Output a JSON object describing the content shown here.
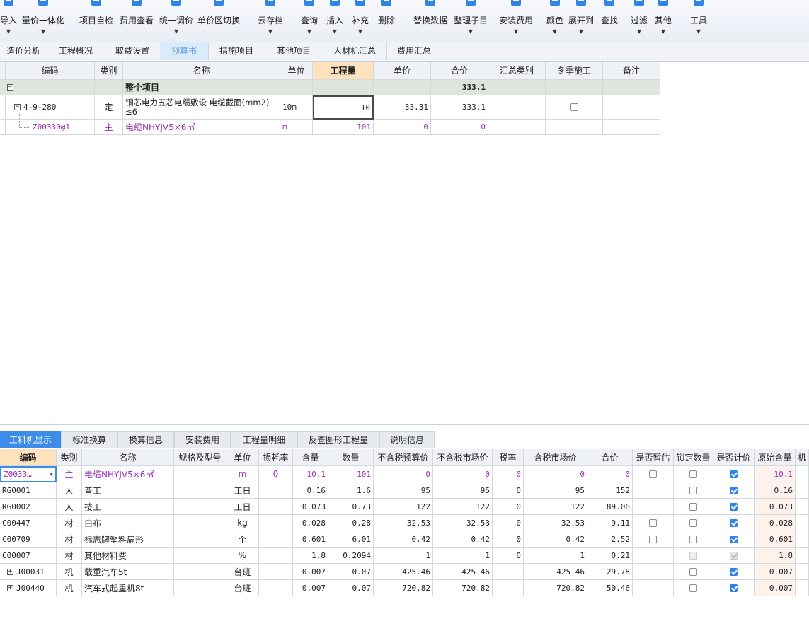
{
  "toolbar": {
    "buttons": [
      {
        "label": "导入",
        "icon": "import-icon",
        "dropdown": true
      },
      {
        "label": "量价一体化",
        "icon": "price-integration-icon",
        "dropdown": true
      },
      {
        "label": "项目自检",
        "icon": "self-check-icon",
        "dropdown": false
      },
      {
        "label": "费用查看",
        "icon": "fee-view-icon",
        "dropdown": false
      },
      {
        "label": "统一调价",
        "icon": "price-adjust-icon",
        "dropdown": true
      },
      {
        "label": "单价区切换",
        "icon": "price-area-switch-icon",
        "dropdown": false
      },
      {
        "label": "云存档",
        "icon": "cloud-archive-icon",
        "dropdown": true
      },
      {
        "label": "查询",
        "icon": "query-icon",
        "dropdown": true
      },
      {
        "label": "插入",
        "icon": "insert-icon",
        "dropdown": true
      },
      {
        "label": "补充",
        "icon": "supplement-icon",
        "dropdown": true
      },
      {
        "label": "删除",
        "icon": "delete-icon",
        "dropdown": false
      },
      {
        "label": "替换数据",
        "icon": "replace-data-icon",
        "dropdown": false
      },
      {
        "label": "整理子目",
        "icon": "organize-items-icon",
        "dropdown": true
      },
      {
        "label": "安装费用",
        "icon": "install-fee-icon",
        "dropdown": true
      },
      {
        "label": "颜色",
        "icon": "color-icon",
        "dropdown": true
      },
      {
        "label": "展开到",
        "icon": "expand-to-icon",
        "dropdown": true
      },
      {
        "label": "查找",
        "icon": "find-icon",
        "dropdown": false
      },
      {
        "label": "过滤",
        "icon": "filter-icon",
        "dropdown": true
      },
      {
        "label": "其他",
        "icon": "other-icon",
        "dropdown": true
      },
      {
        "label": "工具",
        "icon": "tools-icon",
        "dropdown": true
      }
    ]
  },
  "tabs": [
    "造价分析",
    "工程概况",
    "取费设置",
    "预算书",
    "措施项目",
    "其他项目",
    "人材机汇总",
    "费用汇总"
  ],
  "active_tab": "预算书",
  "colors": {
    "accent": "#3d8ce8",
    "group_row": "#dde5dd",
    "selected_header": "#fde2bd",
    "purple_text": "#9b30b7"
  },
  "main_grid": {
    "headers": [
      "编码",
      "类别",
      "名称",
      "单位",
      "工程量",
      "单价",
      "合价",
      "汇总类别",
      "冬季施工",
      "备注"
    ],
    "group_row": {
      "expander": "−",
      "name": "整个项目",
      "total": "333.1"
    },
    "item_row": {
      "expander": "−",
      "code": "4-9-280",
      "type": "定",
      "name_line1": "铜芯电力五芯电缆敷设 电缆截面(mm2)",
      "name_line2": "≤6",
      "unit": "10m",
      "quantity": "10",
      "unit_price": "33.31",
      "total": "333.1",
      "winter_checked": false
    },
    "sub_row": {
      "code": "Z00330@1",
      "type": "主",
      "name": "电缆NHYJV5×6㎡",
      "unit": "m",
      "quantity": "101",
      "unit_price": "0",
      "total": "0"
    }
  },
  "bottom_tabs": [
    "工料机显示",
    "标准换算",
    "换算信息",
    "安装费用",
    "工程量明细",
    "反查图形工程量",
    "说明信息"
  ],
  "bottom_active_tab": "工料机显示",
  "bottom_grid": {
    "headers": [
      "编码",
      "类别",
      "名称",
      "规格及型号",
      "单位",
      "损耗率",
      "含量",
      "数量",
      "不含税预算价",
      "不含税市场价",
      "税率",
      "含税市场价",
      "合价",
      "是否暂估",
      "锁定数量",
      "是否计价",
      "原始含量",
      "机"
    ],
    "rows": [
      {
        "code": "Z0033…",
        "type": "主",
        "name": "电缆NHYJV5×6㎡",
        "spec": "",
        "unit": "m",
        "loss": "0",
        "content": "10.1",
        "qty": "101",
        "budget_price": "0",
        "market_price": "0",
        "tax": "0",
        "tax_market": "0",
        "total": "0",
        "est": "off",
        "lock": "off",
        "priced": "on",
        "orig": "10.1",
        "purple": true,
        "expander": ""
      },
      {
        "code": "RG0001",
        "type": "人",
        "name": "普工",
        "spec": "",
        "unit": "工日",
        "loss": "",
        "content": "0.16",
        "qty": "1.6",
        "budget_price": "95",
        "market_price": "95",
        "tax": "0",
        "tax_market": "95",
        "total": "152",
        "est": "none",
        "lock": "off",
        "priced": "on",
        "orig": "0.16",
        "purple": false,
        "expander": ""
      },
      {
        "code": "RG0002",
        "type": "人",
        "name": "技工",
        "spec": "",
        "unit": "工日",
        "loss": "",
        "content": "0.073",
        "qty": "0.73",
        "budget_price": "122",
        "market_price": "122",
        "tax": "0",
        "tax_market": "122",
        "total": "89.06",
        "est": "none",
        "lock": "off",
        "priced": "on",
        "orig": "0.073",
        "purple": false,
        "expander": ""
      },
      {
        "code": "C00447",
        "type": "材",
        "name": "白布",
        "spec": "",
        "unit": "kg",
        "loss": "",
        "content": "0.028",
        "qty": "0.28",
        "budget_price": "32.53",
        "market_price": "32.53",
        "tax": "0",
        "tax_market": "32.53",
        "total": "9.11",
        "est": "off",
        "lock": "off",
        "priced": "on",
        "orig": "0.028",
        "purple": false,
        "expander": ""
      },
      {
        "code": "C00709",
        "type": "材",
        "name": "标志牌塑料扁形",
        "spec": "",
        "unit": "个",
        "loss": "",
        "content": "0.601",
        "qty": "6.01",
        "budget_price": "0.42",
        "market_price": "0.42",
        "tax": "0",
        "tax_market": "0.42",
        "total": "2.52",
        "est": "off",
        "lock": "off",
        "priced": "on",
        "orig": "0.601",
        "purple": false,
        "expander": ""
      },
      {
        "code": "C00007",
        "type": "材",
        "name": "其他材料费",
        "spec": "",
        "unit": "%",
        "loss": "",
        "content": "1.8",
        "qty": "0.2094",
        "budget_price": "1",
        "market_price": "1",
        "tax": "0",
        "tax_market": "1",
        "total": "0.21",
        "est": "none",
        "lock": "disabled",
        "priced": "disabled",
        "orig": "1.8",
        "purple": false,
        "expander": ""
      },
      {
        "code": "J00031",
        "type": "机",
        "name": "载重汽车5t",
        "spec": "",
        "unit": "台班",
        "loss": "",
        "content": "0.007",
        "qty": "0.07",
        "budget_price": "425.46",
        "market_price": "425.46",
        "tax": "",
        "tax_market": "425.46",
        "total": "29.78",
        "est": "none",
        "lock": "off",
        "priced": "on",
        "orig": "0.007",
        "purple": false,
        "expander": "+"
      },
      {
        "code": "J00440",
        "type": "机",
        "name": "汽车式起重机8t",
        "spec": "",
        "unit": "台班",
        "loss": "",
        "content": "0.007",
        "qty": "0.07",
        "budget_price": "720.82",
        "market_price": "720.82",
        "tax": "",
        "tax_market": "720.82",
        "total": "50.46",
        "est": "none",
        "lock": "off",
        "priced": "on",
        "orig": "0.007",
        "purple": false,
        "expander": "+"
      }
    ]
  }
}
